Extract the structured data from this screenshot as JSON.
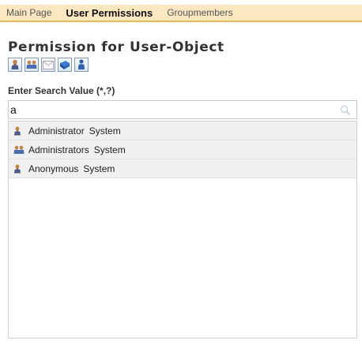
{
  "tabs": [
    {
      "label": "Main Page",
      "active": false
    },
    {
      "label": "User Permissions",
      "active": true
    },
    {
      "label": "Groupmembers",
      "active": false
    }
  ],
  "page_title": "Permission for User-Object",
  "toolbar_icons": [
    "user-icon",
    "group-icon",
    "mail-icon",
    "book-icon",
    "person-icon"
  ],
  "search": {
    "label": "Enter Search Value (*,?)",
    "value": "a"
  },
  "results": [
    {
      "icon": "user-icon",
      "name": "Administrator",
      "type": "System"
    },
    {
      "icon": "group-icon",
      "name": "Administrators",
      "type": "System"
    },
    {
      "icon": "user-icon",
      "name": "Anonymous",
      "type": "System"
    }
  ],
  "colors": {
    "tab_background": "#fbe7c0",
    "tab_border": "#e8b74f",
    "row_background": "#f0f0f0"
  }
}
